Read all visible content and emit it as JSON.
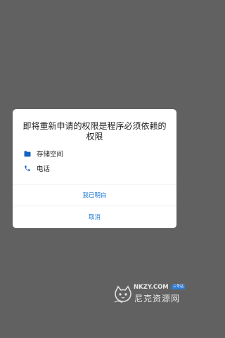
{
  "dialog": {
    "title": "即将重新申请的权限是程序必须依赖的权限",
    "permissions": [
      {
        "label": "存储空间",
        "icon": "folder-icon"
      },
      {
        "label": "电话",
        "icon": "phone-icon"
      }
    ],
    "confirm_label": "我已明白",
    "cancel_label": "取消"
  },
  "watermark": {
    "site": "NKZY.COM",
    "badge": "三号站",
    "name": "尼克资源网"
  },
  "colors": {
    "backdrop": "#616161",
    "accent": "#1976d2",
    "icon": "#1565c0"
  }
}
